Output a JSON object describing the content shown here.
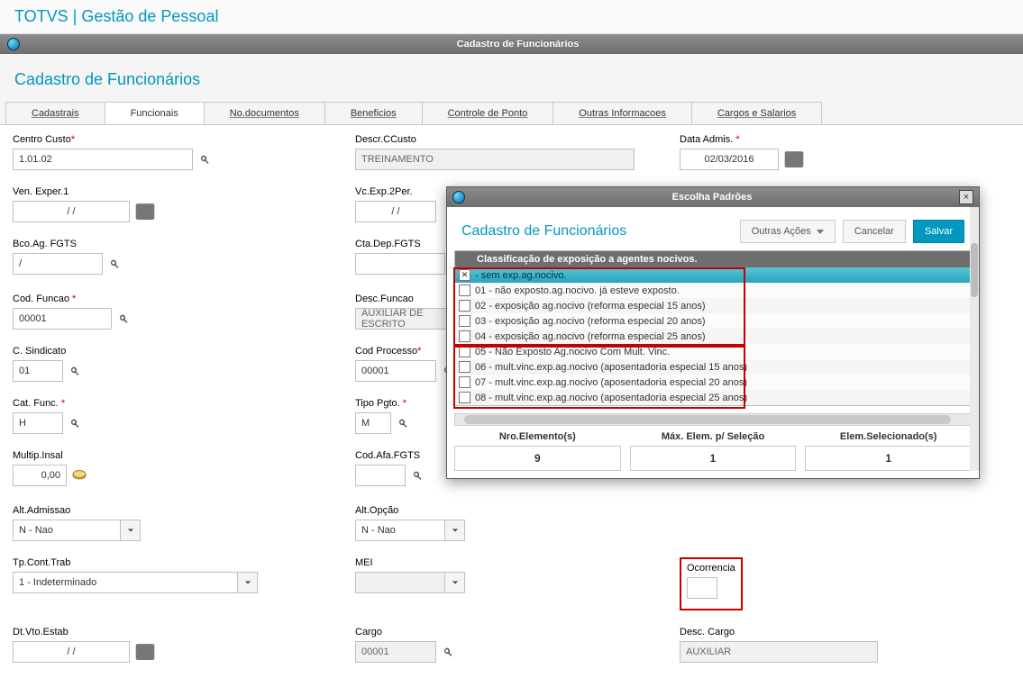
{
  "app_title": "TOTVS | Gestão de Pessoal",
  "window_title": "Cadastro de Funcionários",
  "page_heading": "Cadastro de Funcionários",
  "tabs": [
    "Cadastrais",
    "Funcionais",
    "No.documentos",
    "Beneficios",
    "Controle de Ponto",
    "Outras Informacoes",
    "Cargos e Salarios"
  ],
  "active_tab_index": 1,
  "fields": {
    "centro_custo": {
      "label": "Centro Custo",
      "required": true,
      "value": "1.01.02"
    },
    "descr_ccusto": {
      "label": "Descr.CCusto",
      "value": "TREINAMENTO"
    },
    "data_admis": {
      "label": "Data Admis.",
      "required": true,
      "value": "02/03/2016"
    },
    "ven_exper1": {
      "label": "Ven. Exper.1",
      "value": "  /  /    "
    },
    "vc_exp_2per": {
      "label": "Vc.Exp.2Per.",
      "value": "  /  /    "
    },
    "bco_ag_fgts": {
      "label": "Bco.Ag. FGTS",
      "value": "/"
    },
    "cta_dep_fgts": {
      "label": "Cta.Dep.FGTS",
      "value": ""
    },
    "cod_funcao": {
      "label": "Cod. Funcao",
      "required": true,
      "value": "00001"
    },
    "desc_funcao": {
      "label": "Desc.Funcao",
      "value": "AUXILIAR DE ESCRITO"
    },
    "c_sindicato": {
      "label": "C. Sindicato",
      "value": "01"
    },
    "cod_processo": {
      "label": "Cod Processo",
      "required": true,
      "value": "00001"
    },
    "cat_func": {
      "label": "Cat. Func.",
      "required": true,
      "value": "H"
    },
    "tipo_pgto": {
      "label": "Tipo Pgto.",
      "required": true,
      "value": "M"
    },
    "multip_insal": {
      "label": "Multip.Insal",
      "value": "0,00"
    },
    "cod_afa_fgts": {
      "label": "Cod.Afa.FGTS",
      "value": ""
    },
    "alt_admissao": {
      "label": "Alt.Admissao",
      "value": "N - Nao"
    },
    "alt_opcao": {
      "label": "Alt.Opção",
      "value": "N - Nao"
    },
    "tp_cont_trab": {
      "label": "Tp.Cont.Trab",
      "value": "1 - Indeterminado"
    },
    "mei": {
      "label": "MEI",
      "value": ""
    },
    "ocorrencia": {
      "label": "Ocorrencia",
      "value": ""
    },
    "dt_vto_estab": {
      "label": "Dt.Vto.Estab",
      "value": "  /  /    "
    },
    "cargo": {
      "label": "Cargo",
      "value": "00001"
    },
    "desc_cargo": {
      "label": "Desc. Cargo",
      "value": "AUXILIAR"
    }
  },
  "modal": {
    "header": "Escolha Padrões",
    "title": "Cadastro de Funcionários",
    "btn_outras": "Outras Ações",
    "btn_cancel": "Cancelar",
    "btn_save": "Salvar",
    "list_header": "Classificação de exposição a agentes nocivos.",
    "rows": [
      {
        "checked": true,
        "text": "  - sem exp.ag.nocivo."
      },
      {
        "checked": false,
        "text": "01 - não exposto.ag.nocivo. já esteve exposto."
      },
      {
        "checked": false,
        "text": "02 - exposição ag.nocivo (reforma especial 15 anos)"
      },
      {
        "checked": false,
        "text": "03 - exposição ag.nocivo (reforma especial 20 anos)"
      },
      {
        "checked": false,
        "text": "04 - exposição ag.nocivo (reforma especial 25 anos)"
      },
      {
        "checked": false,
        "text": "05 - Não Exposto Ag.nocivo Com Mult. Vinc."
      },
      {
        "checked": false,
        "text": "06 - mult.vinc.exp.ag.nocivo (aposentadoria especial 15 anos)"
      },
      {
        "checked": false,
        "text": "07 - mult.vinc.exp.ag.nocivo (aposentadoria especial 20 anos)"
      },
      {
        "checked": false,
        "text": "08 - mult.vinc.exp.ag.nocivo (aposentadoria especial 25 anos)"
      }
    ],
    "stats": {
      "nro_label": "Nro.Elemento(s)",
      "nro_value": "9",
      "max_label": "Máx. Elem. p/ Seleção",
      "max_value": "1",
      "sel_label": "Elem.Selecionado(s)",
      "sel_value": "1"
    }
  }
}
